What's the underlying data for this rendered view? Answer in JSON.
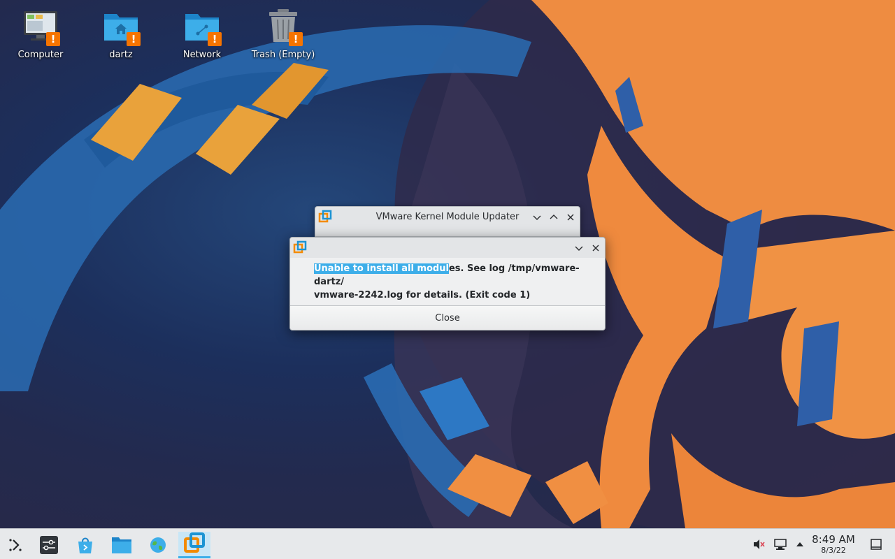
{
  "desktop": {
    "icons": [
      {
        "label": "Computer",
        "icon": "computer-icon",
        "badge": "!"
      },
      {
        "label": "dartz",
        "icon": "home-folder-icon",
        "badge": "!"
      },
      {
        "label": "Network",
        "icon": "network-folder-icon",
        "badge": "!"
      },
      {
        "label": "Trash (Empty)",
        "icon": "trash-icon",
        "badge": "!"
      }
    ]
  },
  "back_window": {
    "title": "VMware Kernel Module Updater"
  },
  "dialog": {
    "message_selected": "Unable to install all modul",
    "message_rest": "es. See log /tmp/vmware-dartz/",
    "message_line2": "vmware-2242.log for details. (Exit code 1)",
    "close_label": "Close"
  },
  "taskbar": {
    "launchers": [
      "application-launcher-icon",
      "system-settings-icon",
      "discover-store-icon",
      "file-manager-icon",
      "web-browser-icon",
      "vmware-icon"
    ],
    "active": "vmware-icon",
    "tray": [
      "volume-muted-icon",
      "network-wired-icon",
      "expand-tray-arrow-icon"
    ],
    "clock_time": "8:49 AM",
    "clock_date": "8/3/22"
  },
  "colors": {
    "accent": "#3daee9",
    "warning": "#f67400",
    "vmware_orange": "#f38b00",
    "vmware_blue": "#1d94d3"
  }
}
